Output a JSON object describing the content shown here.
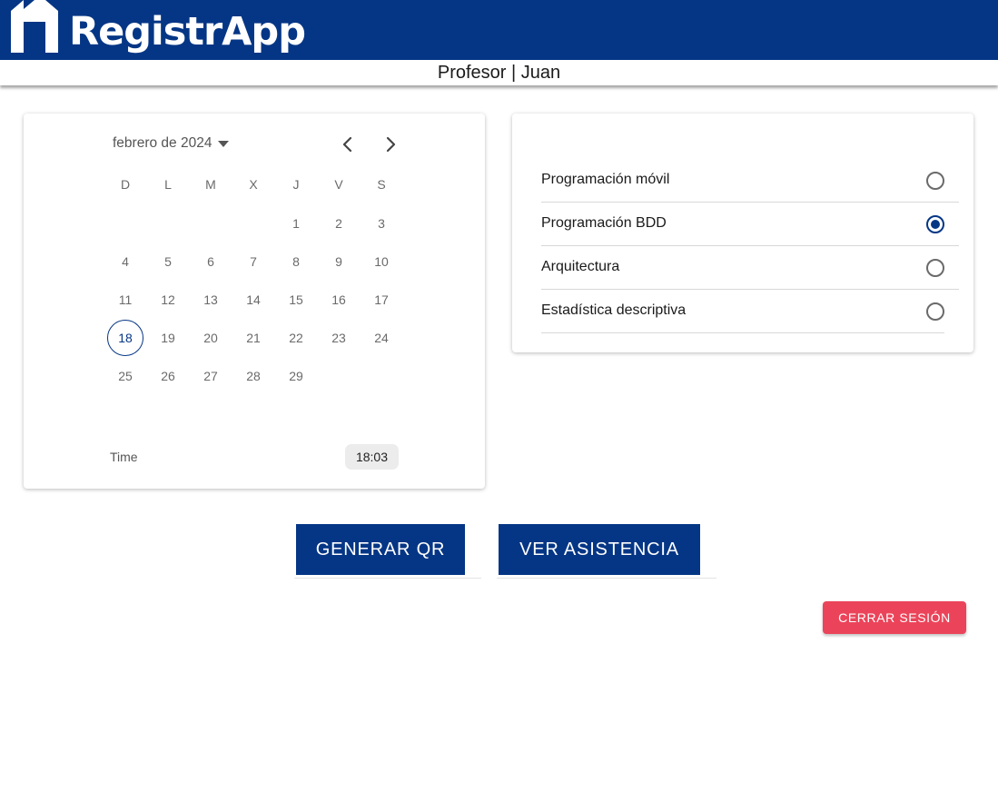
{
  "header": {
    "app_name": "RegistrApp",
    "brand_color": "#053685",
    "logo_icon": "house-mark-icon"
  },
  "subheader": {
    "text": "Profesor | Juan"
  },
  "calendar": {
    "month_label": "febrero de 2024",
    "prev_icon": "chevron-left-icon",
    "next_icon": "chevron-right-icon",
    "weekdays": [
      "D",
      "L",
      "M",
      "X",
      "J",
      "V",
      "S"
    ],
    "days": [
      "1",
      "2",
      "3",
      "4",
      "5",
      "6",
      "7",
      "8",
      "9",
      "10",
      "11",
      "12",
      "13",
      "14",
      "15",
      "16",
      "17",
      "18",
      "19",
      "20",
      "21",
      "22",
      "23",
      "24",
      "25",
      "26",
      "27",
      "28",
      "29"
    ],
    "selected_day": "18",
    "time_label": "Time",
    "time_value": "18:03"
  },
  "subjects": {
    "items": [
      {
        "label": "Programación móvil",
        "checked": false
      },
      {
        "label": "Programación BDD",
        "checked": true
      },
      {
        "label": "Arquitectura",
        "checked": false
      },
      {
        "label": "Estadística descriptiva",
        "checked": false
      }
    ]
  },
  "actions": {
    "generate_qr": "GENERAR QR",
    "view_attendance": "VER ASISTENCIA",
    "logout": "CERRAR SESIÓN",
    "logout_color": "#eb445a"
  }
}
